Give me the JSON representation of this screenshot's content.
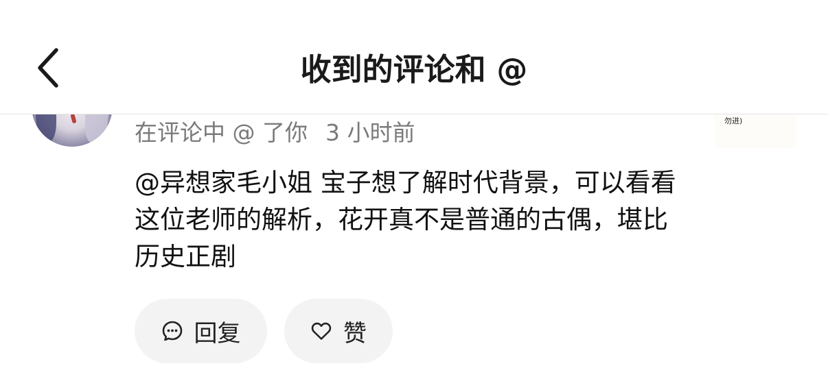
{
  "header": {
    "title": "收到的评论和 @",
    "back_icon": "chevron-left-icon"
  },
  "notification": {
    "action_text": "在评论中 @ 了你",
    "time": "3 小时前",
    "thumbnail_text": "勿进)",
    "comment_text": "@异想家毛小姐 宝子想了解时代背景，可以看看这位老师的解析，花开真不是普通的古偶，堪比历史正剧"
  },
  "actions": {
    "reply_label": "回复",
    "reply_icon": "comment-bubble-icon",
    "like_label": "赞",
    "like_icon": "heart-icon"
  }
}
